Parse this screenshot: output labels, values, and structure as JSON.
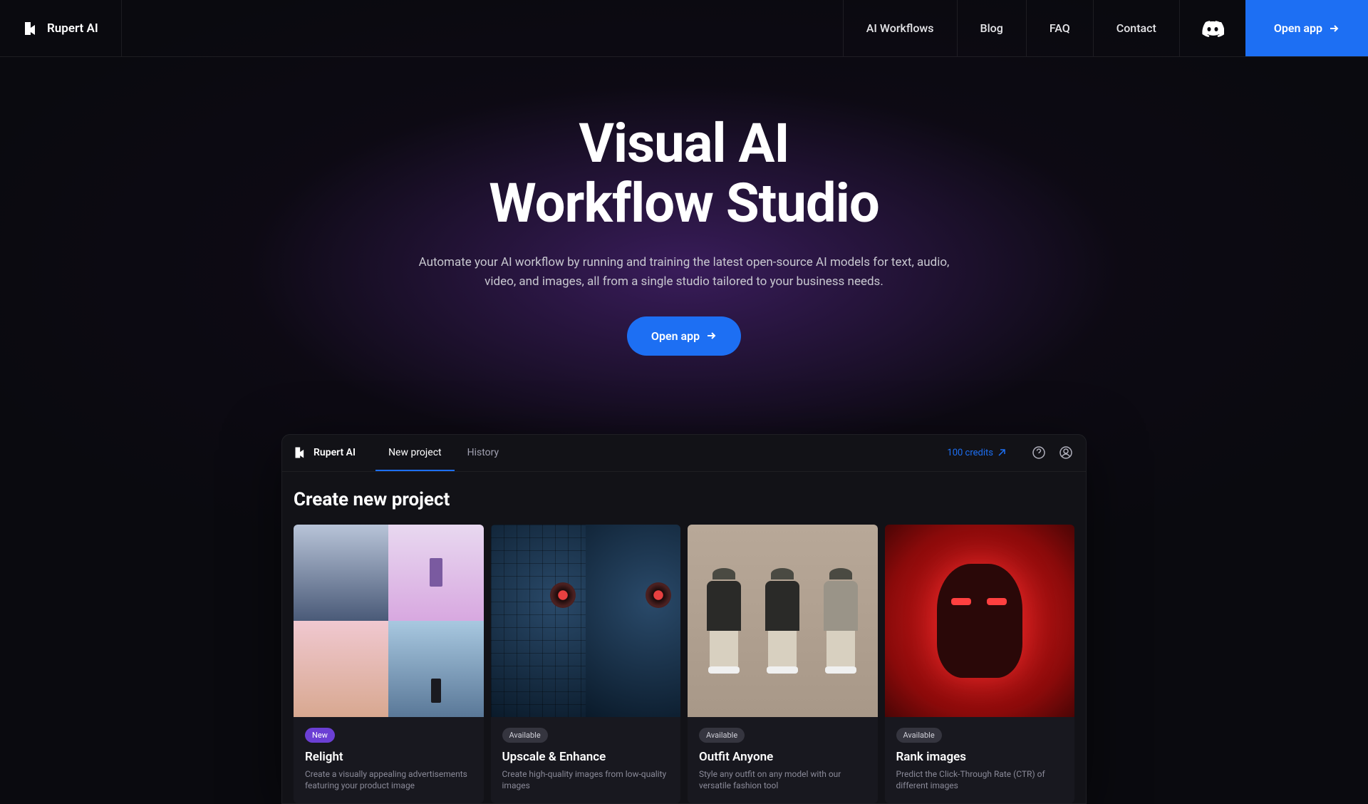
{
  "brand": "Rupert AI",
  "nav": {
    "workflows": "AI Workflows",
    "blog": "Blog",
    "faq": "FAQ",
    "contact": "Contact",
    "open_app": "Open app"
  },
  "hero": {
    "title_line1": "Visual AI",
    "title_line2": "Workflow Studio",
    "subtitle": "Automate your AI workflow by running and training the latest open-source AI models for text, audio, video, and images, all from a single studio tailored to your business needs.",
    "cta": "Open app"
  },
  "app": {
    "brand": "Rupert AI",
    "tabs": {
      "new_project": "New project",
      "history": "History"
    },
    "credits": "100 credits",
    "section_title": "Create new project",
    "cards": [
      {
        "badge": "New",
        "badge_class": "new",
        "title": "Relight",
        "desc": "Create a visually appealing advertisements featuring your product image"
      },
      {
        "badge": "Available",
        "badge_class": "available",
        "title": "Upscale & Enhance",
        "desc": "Create high-quality images from low-quality images"
      },
      {
        "badge": "Available",
        "badge_class": "available",
        "title": "Outfit Anyone",
        "desc": "Style any outfit on any model with our versatile fashion tool"
      },
      {
        "badge": "Available",
        "badge_class": "available",
        "title": "Rank images",
        "desc": "Predict the Click-Through Rate (CTR) of different images"
      }
    ]
  }
}
